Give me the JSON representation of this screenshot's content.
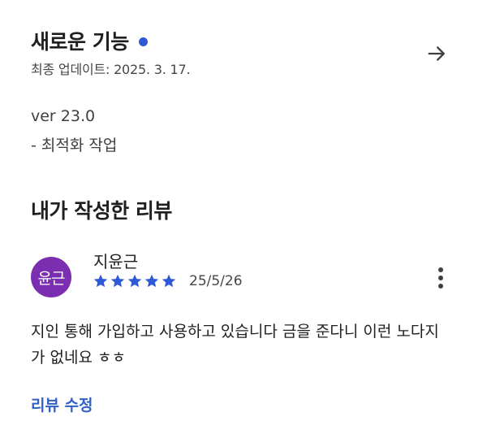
{
  "whats_new": {
    "title": "새로운 기능",
    "last_updated": "최종 업데이트: 2025. 3. 17.",
    "version": "ver 23.0",
    "note": "- 최적화 작업",
    "dot_color": "#2f59d6",
    "arrow_icon": "arrow-right-icon"
  },
  "my_review": {
    "heading": "내가 작성한 리뷰",
    "avatar_text": "윤근",
    "avatar_color": "#7b2fb0",
    "reviewer_name": "지윤근",
    "rating": 5,
    "rating_max": 5,
    "star_color": "#2f59d6",
    "date": "25/5/26",
    "text": "지인 통해 가입하고 사용하고 있습니다 금을 준다니 이런 노다지가 없네요 ㅎㅎ",
    "edit_label": "리뷰 수정",
    "more_icon": "more-vert-icon"
  }
}
